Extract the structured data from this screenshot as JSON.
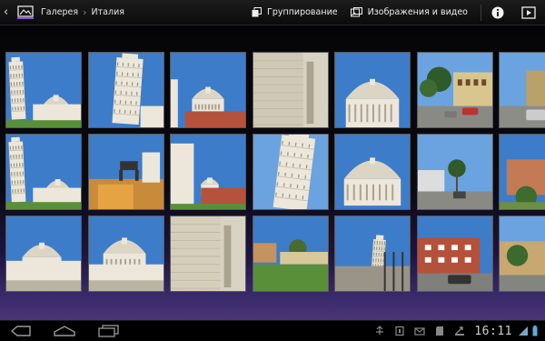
{
  "action_bar": {
    "back_icon": "back-chevron-icon",
    "app_icon": "gallery-icon",
    "breadcrumb_root": "Галерея",
    "breadcrumb_current": "Италия",
    "group_by_label": "Группирование",
    "media_filter_label": "Изображения и видео",
    "info_icon": "info-icon",
    "slideshow_icon": "slideshow-play-icon"
  },
  "photo_grid": {
    "columns": 7,
    "rows": 3,
    "tiles": [
      {
        "subject": "Leaning Tower and Cathedral"
      },
      {
        "subject": "Leaning Tower"
      },
      {
        "subject": "Cathedral dome"
      },
      {
        "subject": "Marble wall close-up"
      },
      {
        "subject": "Baptistery dome"
      },
      {
        "subject": "Street with parked cars"
      },
      {
        "subject": "Street with houses"
      },
      {
        "subject": "Leaning Tower and Cathedral"
      },
      {
        "subject": "Wolf statue and buildings"
      },
      {
        "subject": "Cathedral facade"
      },
      {
        "subject": "Leaning Tower top"
      },
      {
        "subject": "Baptistery"
      },
      {
        "subject": "Palm tree street"
      },
      {
        "subject": "Red villa"
      },
      {
        "subject": "Cathedral and Baptistery"
      },
      {
        "subject": "Baptistery facade"
      },
      {
        "subject": "Marble wall"
      },
      {
        "subject": "Lawn and buildings"
      },
      {
        "subject": "Tower and wall"
      },
      {
        "subject": "Apartment building"
      },
      {
        "subject": "Corner building"
      }
    ]
  },
  "nav_bar": {
    "back_icon": "nav-back-icon",
    "home_icon": "nav-home-icon",
    "recents_icon": "nav-recent-apps-icon",
    "clock": "16:11",
    "status_icons": [
      "usb-debug-icon",
      "notification-icon",
      "email-icon",
      "sd-card-icon",
      "download-icon",
      "wifi-icon",
      "battery-icon"
    ]
  },
  "colors": {
    "action_bar_bg": "#111111",
    "accent": "#33b5e5",
    "sky": "#3a76c4",
    "marble": "#e8e3d6",
    "background_glow": "#4a3578"
  }
}
